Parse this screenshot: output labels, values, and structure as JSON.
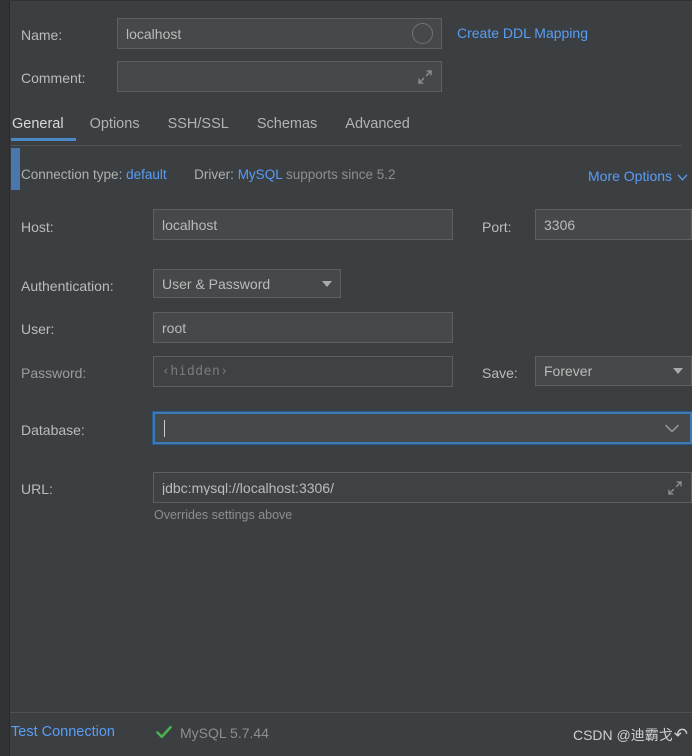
{
  "theme": {
    "panel_bg": "#3c3f41",
    "field_bg": "#45494a",
    "accent_blue": "#4a88c7",
    "link_blue": "#589df6",
    "text": "#bbbbbb",
    "muted": "#8b8f90",
    "success_green": "#4caf50",
    "focus_border": "#3d7ab5"
  },
  "header": {
    "name_label": "Name:",
    "name_value": "localhost",
    "name_refresh_icon": "circle-icon",
    "comment_label": "Comment:",
    "comment_value": "",
    "comment_expand_icon": "expand-arrows-icon",
    "create_ddl_link": "Create DDL Mapping"
  },
  "tabs": [
    {
      "label": "General",
      "active": true
    },
    {
      "label": "Options",
      "active": false
    },
    {
      "label": "SSH/SSL",
      "active": false
    },
    {
      "label": "Schemas",
      "active": false
    },
    {
      "label": "Advanced",
      "active": false
    }
  ],
  "meta": {
    "connection_type_label": "Connection type:",
    "connection_type_value": "default",
    "driver_label": "Driver:",
    "driver_value": "MySQL",
    "driver_note": "supports since 5.2",
    "more_options_label": "More Options",
    "more_options_icon": "chevron-down-icon"
  },
  "form": {
    "host_label": "Host:",
    "host_value": "localhost",
    "port_label": "Port:",
    "port_value": "3306",
    "auth_label": "Authentication:",
    "auth_value": "User & Password",
    "auth_dropdown_icon": "triangle-down-icon",
    "user_label": "User:",
    "user_value": "root",
    "password_label": "Password:",
    "password_placeholder": "‹hidden›",
    "save_label": "Save:",
    "save_value": "Forever",
    "save_dropdown_icon": "triangle-down-icon",
    "database_label": "Database:",
    "database_value": "",
    "database_dropdown_icon": "chevron-down-icon",
    "url_label": "URL:",
    "url_value": "jdbc:mysql://localhost:3306/",
    "url_expand_icon": "expand-arrows-icon",
    "url_hint": "Overrides settings above"
  },
  "status": {
    "test_connection_label": "Test Connection",
    "status_icon": "check-icon",
    "db_version": "MySQL 5.7.44",
    "watermark_text": "CSDN @迪霸戈",
    "watermark_icon": "undo-arrow-icon",
    "watermark_arrow_glyph": "↶"
  }
}
